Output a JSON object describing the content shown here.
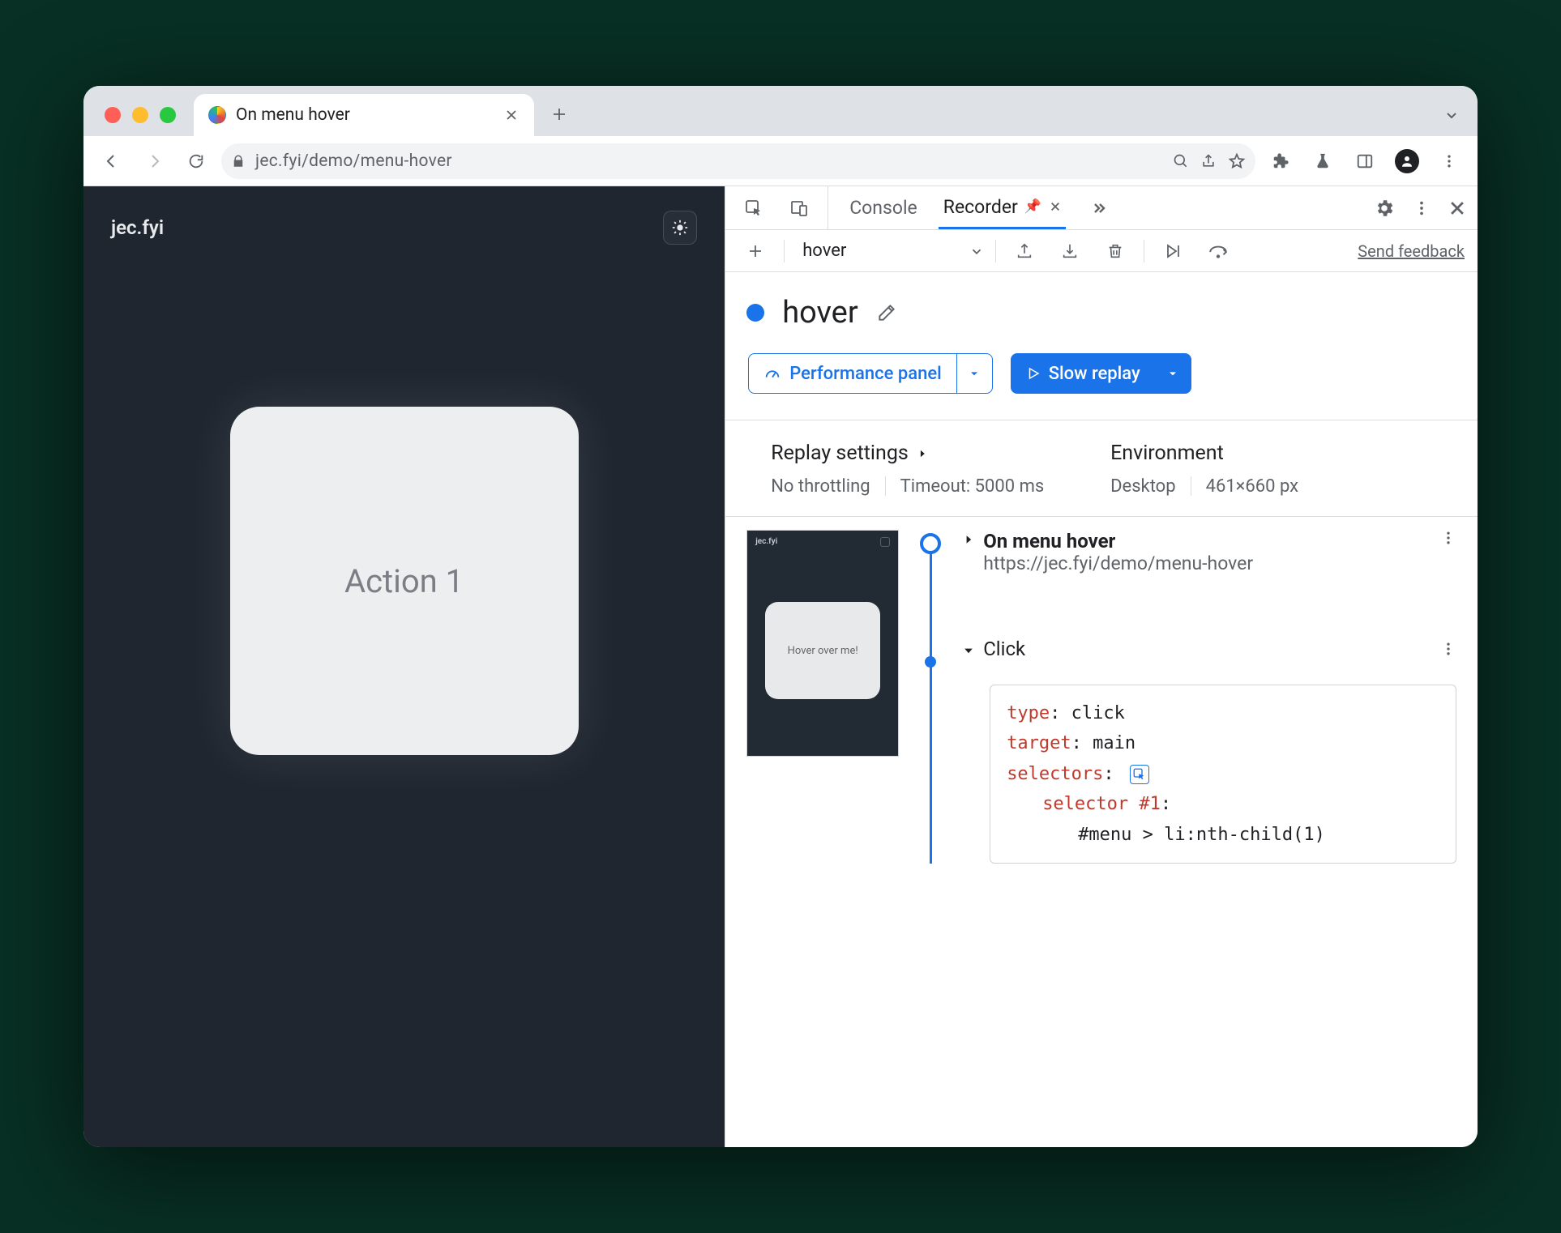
{
  "tab": {
    "title": "On menu hover"
  },
  "url": "jec.fyi/demo/menu-hover",
  "page": {
    "brand": "jec.fyi",
    "card": "Action 1"
  },
  "dt": {
    "tabs": {
      "console": "Console",
      "recorder": "Recorder"
    },
    "bar": {
      "name": "hover",
      "feedback": "Send feedback"
    },
    "rec": {
      "title": "hover"
    },
    "buttons": {
      "perf": "Performance panel",
      "replay": "Slow replay"
    },
    "settings": {
      "replay_title": "Replay settings",
      "throttling": "No throttling",
      "timeout": "Timeout: 5000 ms",
      "env_title": "Environment",
      "device": "Desktop",
      "viewport": "461×660 px"
    },
    "thumb_label": "Hover over me!",
    "step_nav": {
      "title": "On menu hover",
      "url": "https://jec.fyi/demo/menu-hover"
    },
    "step_click": {
      "label": "Click",
      "type_k": "type",
      "type_v": ": click",
      "target_k": "target",
      "target_v": ": main",
      "selectors_k": "selectors",
      "selectors_v": ":",
      "sel_k": "selector ",
      "sel_num": "#1",
      "sel_colon": ":",
      "sel_body": "#menu > li:nth-child(1)"
    }
  }
}
